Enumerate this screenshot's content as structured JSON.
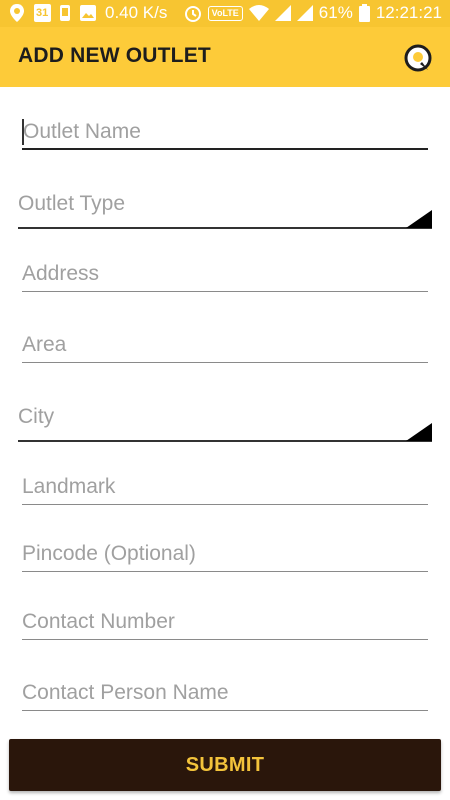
{
  "status_bar": {
    "calendar_day": "31",
    "net_speed": "0.40 K/s",
    "volte": "VoLTE",
    "battery": "61%",
    "time": "12:21:21"
  },
  "app_bar": {
    "title": "ADD NEW OUTLET",
    "logo_icon": "q-logo-icon"
  },
  "form": {
    "outlet_name": {
      "placeholder": "Outlet Name",
      "value": ""
    },
    "outlet_type": {
      "placeholder": "Outlet Type",
      "value": ""
    },
    "address": {
      "placeholder": "Address",
      "value": ""
    },
    "area": {
      "placeholder": "Area",
      "value": ""
    },
    "city": {
      "placeholder": "City",
      "value": ""
    },
    "landmark": {
      "placeholder": "Landmark",
      "value": ""
    },
    "pincode": {
      "placeholder": "Pincode (Optional)",
      "value": ""
    },
    "contact_number": {
      "placeholder": "Contact Number",
      "value": ""
    },
    "contact_person": {
      "placeholder": "Contact Person Name",
      "value": ""
    }
  },
  "submit_label": "SUBMIT",
  "colors": {
    "accent": "#fdcb39",
    "button_bg": "#2a160b",
    "button_text": "#f3c33b"
  }
}
